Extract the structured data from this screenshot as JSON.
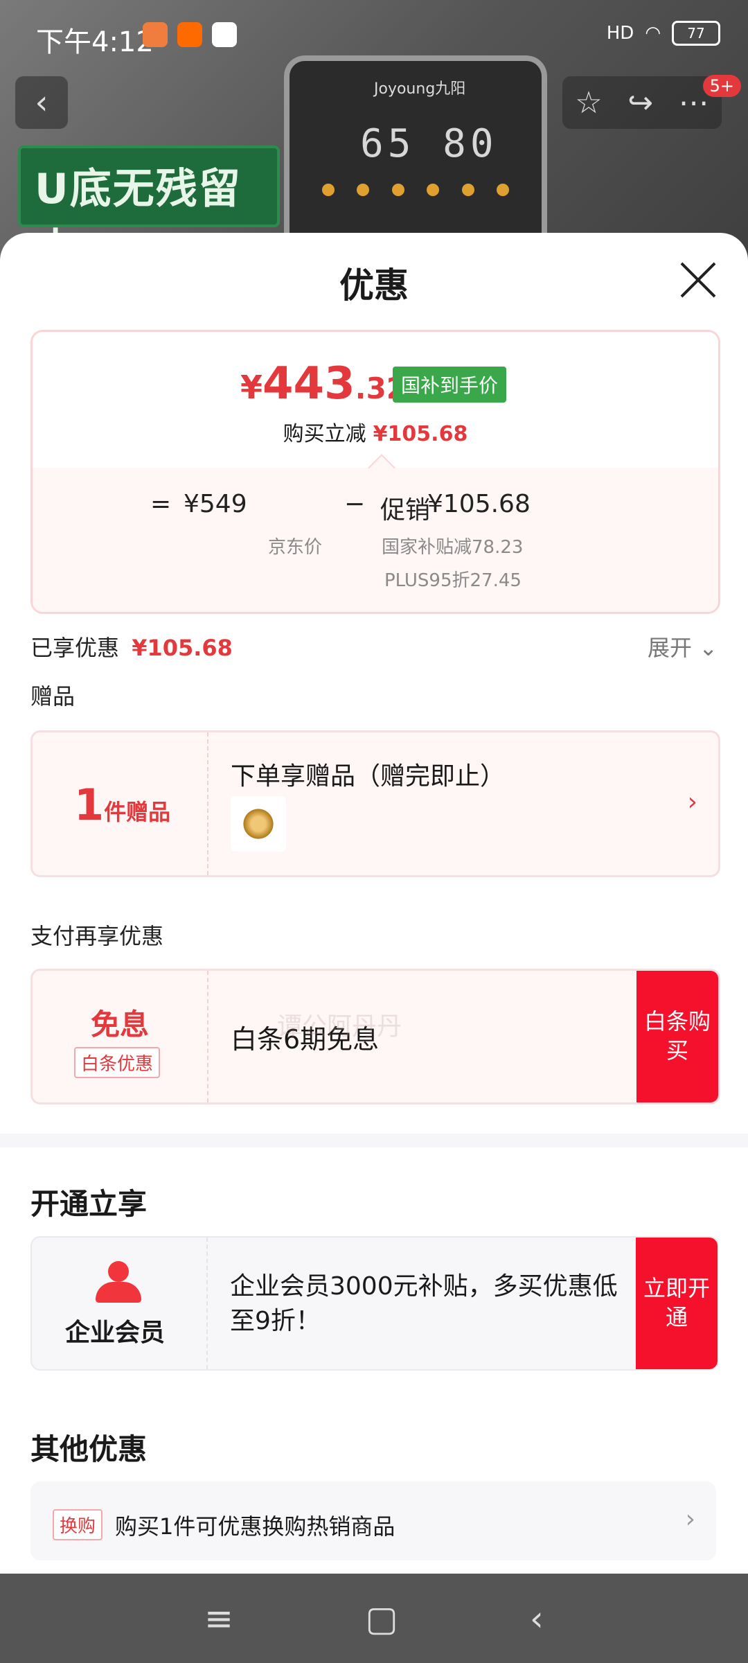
{
  "status_bar": {
    "time": "下午4:12",
    "battery": "77",
    "signal_label": "HD"
  },
  "background": {
    "banner_text": "U底无残留水",
    "device_brand": "Joyoung九阳",
    "device_digits": "65 80"
  },
  "top_nav": {
    "badge": "5+"
  },
  "sheet": {
    "title": "优惠",
    "price_card": {
      "currency": "¥",
      "price_int": "443",
      "price_dec": ".32",
      "tag": "国补到手价",
      "instant_label": "购买立减",
      "instant_value": "¥105.68",
      "equals": "=",
      "jd_price": "¥549",
      "minus": "−",
      "promo_label": "促销",
      "promo_value": "¥105.68",
      "jd_price_label": "京东价",
      "subsidy_line": "国家补贴减78.23",
      "plus_line": "PLUS95折27.45"
    },
    "enjoyed": {
      "label": "已享优惠",
      "value": "¥105.68",
      "expand": "展开"
    },
    "gift": {
      "section": "赠品",
      "count": "1",
      "count_unit": "件赠品",
      "title": "下单享赠品（赠完即止）"
    },
    "pay": {
      "section": "支付再享优惠",
      "main": "免息",
      "sub": "白条优惠",
      "text": "白条6期免息",
      "button": "白条购买"
    },
    "open": {
      "section": "开通立享",
      "label": "企业会员",
      "text": "企业会员3000元补贴，多买优惠低至9折！",
      "button": "立即开通"
    },
    "other": {
      "section": "其他优惠",
      "tag": "换购",
      "text": "购买1件可优惠换购热销商品"
    },
    "watermark": "谭公阿丹丹"
  }
}
